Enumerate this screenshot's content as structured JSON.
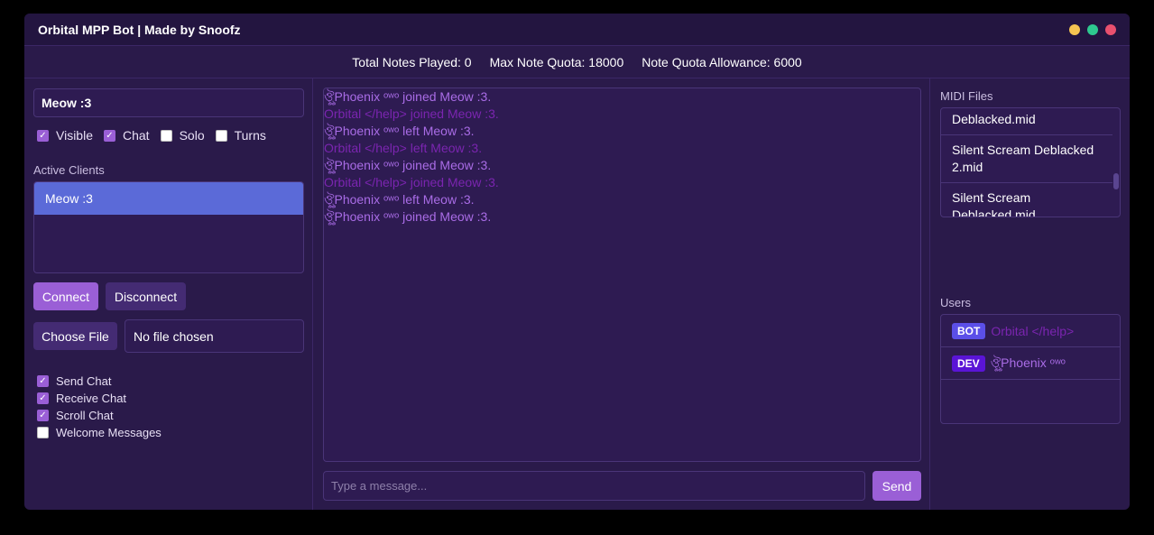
{
  "window": {
    "title": "Orbital MPP Bot | Made by Snoofz",
    "dots": [
      {
        "name": "minimize-dot",
        "color": "#f5c451"
      },
      {
        "name": "maximize-dot",
        "color": "#2ec98f"
      },
      {
        "name": "close-dot",
        "color": "#e8506e"
      }
    ]
  },
  "stats": {
    "total_notes": "Total Notes Played: 0",
    "max_quota": "Max Note Quota: 18000",
    "allowance": "Note Quota Allowance: 6000"
  },
  "left": {
    "room_value": "Meow :3",
    "room_checks": [
      {
        "label": "Visible",
        "checked": true
      },
      {
        "label": "Chat",
        "checked": true
      },
      {
        "label": "Solo",
        "checked": false
      },
      {
        "label": "Turns",
        "checked": false
      }
    ],
    "active_clients_label": "Active Clients",
    "clients": [
      "Meow :3"
    ],
    "connect_label": "Connect",
    "disconnect_label": "Disconnect",
    "choose_file_label": "Choose File",
    "file_status": "No file chosen",
    "options": [
      {
        "label": "Send Chat",
        "checked": true
      },
      {
        "label": "Receive Chat",
        "checked": true
      },
      {
        "label": "Scroll Chat",
        "checked": true
      },
      {
        "label": "Welcome Messages",
        "checked": false
      }
    ]
  },
  "chat": {
    "lines": [
      {
        "text": "ঔৣPhoenix ᵒʷᵒ joined Meow :3.",
        "color": "#a96ce6"
      },
      {
        "text": "Orbital </help> joined Meow :3.",
        "color": "#7b25b0"
      },
      {
        "text": "ঔৣPhoenix ᵒʷᵒ left Meow :3.",
        "color": "#a96ce6"
      },
      {
        "text": "Orbital </help> left Meow :3.",
        "color": "#7b25b0"
      },
      {
        "text": "ঔৣPhoenix ᵒʷᵒ joined Meow :3.",
        "color": "#a96ce6"
      },
      {
        "text": "Orbital </help> joined Meow :3.",
        "color": "#7b25b0"
      },
      {
        "text": "ঔৣPhoenix ᵒʷᵒ left Meow :3.",
        "color": "#a96ce6"
      },
      {
        "text": "ঔৣPhoenix ᵒʷᵒ joined Meow :3.",
        "color": "#a96ce6"
      }
    ],
    "input_placeholder": "Type a message...",
    "send_label": "Send"
  },
  "right": {
    "midi_label": "MIDI Files",
    "midi_files": [
      "Deblacked.mid",
      "Silent Scream Deblacked 2.mid",
      "Silent Scream Deblacked.mid"
    ],
    "users_label": "Users",
    "users": [
      {
        "badge": "BOT",
        "badge_color": "#5b4fe8",
        "name": "Orbital </help>",
        "name_color": "#7b25b0"
      },
      {
        "badge": "DEV",
        "badge_color": "#5a14d6",
        "name": "ঔৣPhoenix ᵒʷᵒ",
        "name_color": "#a96ce6"
      }
    ]
  }
}
